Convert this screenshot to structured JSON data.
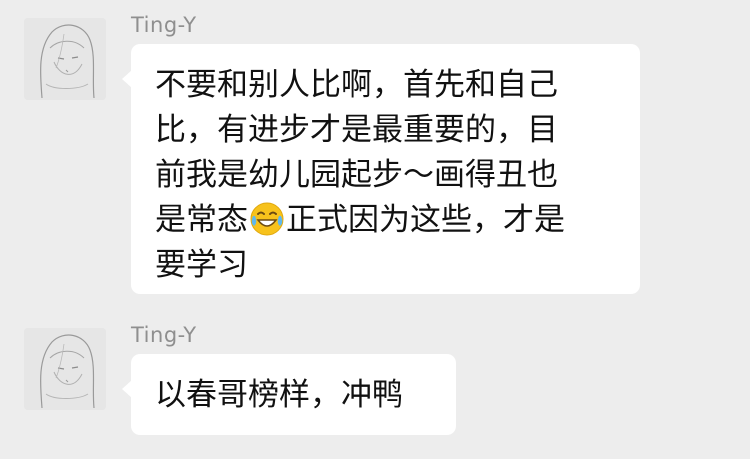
{
  "messages": [
    {
      "sender": "Ting-Y",
      "avatar_icon": "sketch-girl-avatar-icon",
      "lines": [
        "不要和别人比啊，首先和自己",
        "比，有进步才是最重要的，目",
        "前我是幼儿园起步～画得丑也",
        "是常态",
        "正式因为这些，才是",
        "要学习"
      ],
      "emoji": "tears-of-joy-emoji"
    },
    {
      "sender": "Ting-Y",
      "avatar_icon": "sketch-girl-avatar-icon",
      "lines": [
        "以春哥榜样，冲鸭"
      ]
    }
  ],
  "colors": {
    "background": "#ededed",
    "bubble": "#ffffff",
    "sender_name": "#8f8f8f",
    "text": "#111111",
    "emoji_face": "#f7c21c"
  }
}
